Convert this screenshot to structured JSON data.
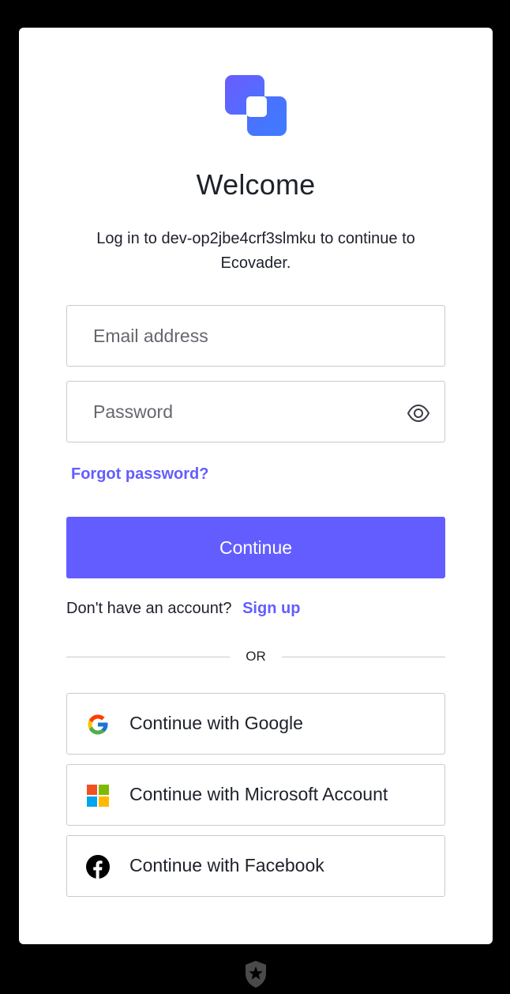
{
  "header": {
    "title": "Welcome",
    "subtitle": "Log in to dev-op2jbe4crf3slmku to continue to Ecovader."
  },
  "form": {
    "email_placeholder": "Email address",
    "password_placeholder": "Password",
    "forgot_password": "Forgot password?",
    "continue_label": "Continue"
  },
  "signup": {
    "prompt": "Don't have an account?",
    "link": "Sign up"
  },
  "divider": {
    "text": "OR"
  },
  "social": {
    "google": "Continue with Google",
    "microsoft": "Continue with Microsoft Account",
    "facebook": "Continue with Facebook"
  },
  "colors": {
    "accent": "#635dff",
    "background": "#000000",
    "card": "#ffffff",
    "text": "#1e212a",
    "border": "#c9cace"
  },
  "icons": {
    "logo": "app-logo-icon",
    "password_toggle": "eye-icon",
    "google": "google-icon",
    "microsoft": "microsoft-icon",
    "facebook": "facebook-icon",
    "footer": "auth0-shield-icon"
  }
}
